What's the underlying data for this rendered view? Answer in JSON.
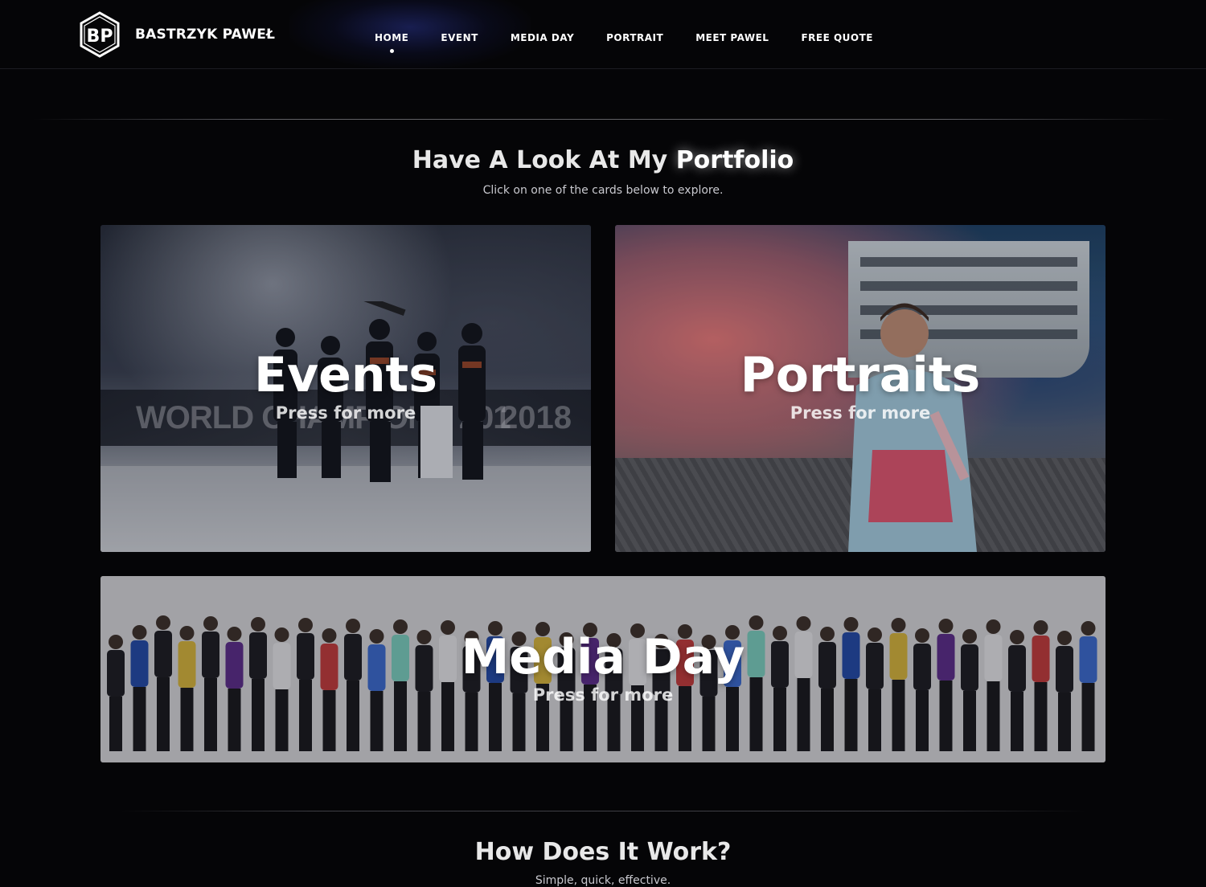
{
  "header": {
    "brand": "BASTRZYK PAWEŁ",
    "logo_icon": "bp-monogram-hexagon-icon",
    "nav": [
      {
        "label": "HOME",
        "active": true
      },
      {
        "label": "EVENT",
        "active": false
      },
      {
        "label": "MEDIA DAY",
        "active": false
      },
      {
        "label": "PORTRAIT",
        "active": false
      },
      {
        "label": "MEET PAWEL",
        "active": false
      },
      {
        "label": "FREE QUOTE",
        "active": false
      }
    ]
  },
  "portfolio": {
    "title_prefix": "Have A Look At My",
    "title_highlight": "Portfolio",
    "subtitle": "Click on one of the cards below to explore.",
    "cards": [
      {
        "title": "Events",
        "cta": "Press for more",
        "banner_left": "WORLD CHAMPIONS 201",
        "banner_right": "2018"
      },
      {
        "title": "Portraits",
        "cta": "Press for more"
      },
      {
        "title": "Media Day",
        "cta": "Press for more"
      }
    ]
  },
  "how": {
    "title": "How Does It Work?",
    "subtitle": "Simple, quick, effective."
  },
  "colors": {
    "background": "#050507",
    "text": "#ffffff",
    "muted": "#c9c9cf"
  }
}
